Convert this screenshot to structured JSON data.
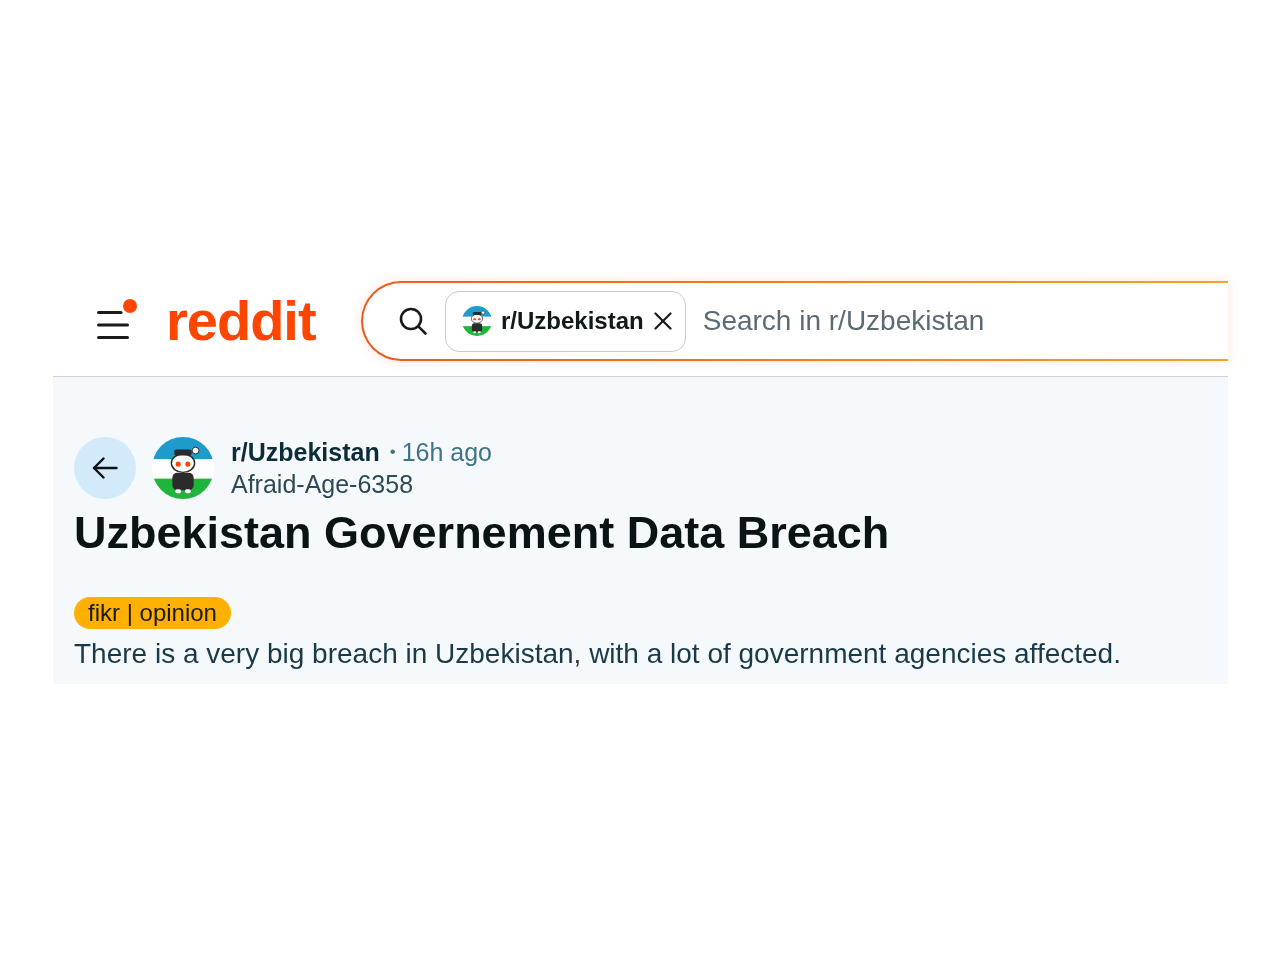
{
  "header": {
    "menu": {
      "notification_dot": true
    },
    "logo": "reddit",
    "search": {
      "chip": {
        "label": "r/Uzbekistan"
      },
      "placeholder": "Search in r/Uzbekistan"
    }
  },
  "post": {
    "subreddit": "r/Uzbekistan",
    "separator": "•",
    "time": "16h ago",
    "author": "Afraid-Age-6358",
    "title": "Uzbekistan Governement Data Breach",
    "flair": "fikr | opinion",
    "body": "There is a very big breach in Uzbekistan, with a lot of government agencies affected."
  }
}
